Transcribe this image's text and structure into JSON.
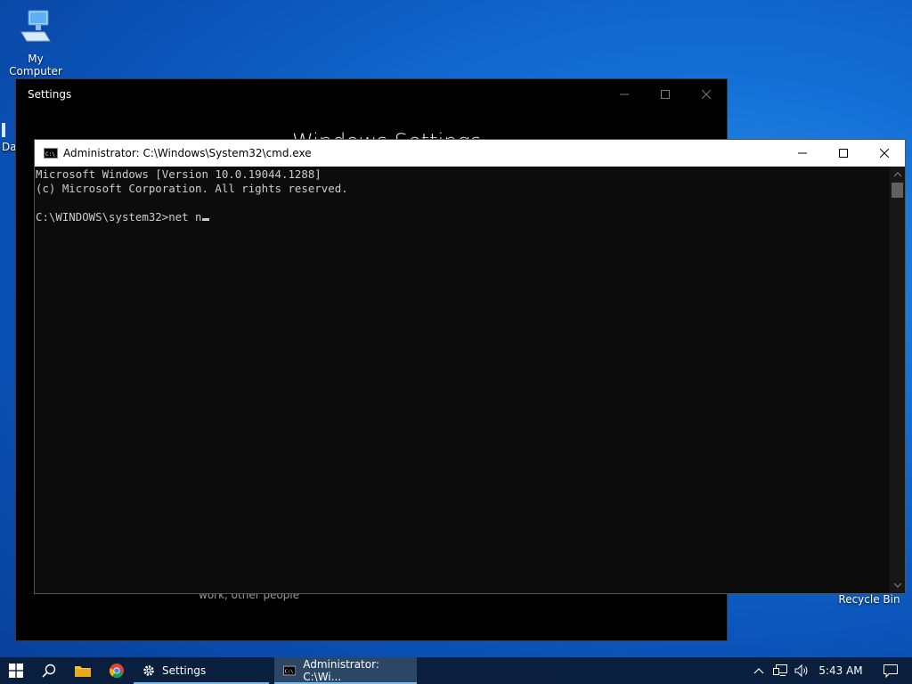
{
  "desktop": {
    "icons": [
      {
        "label": "My Computer",
        "icon": "computer-icon"
      },
      {
        "label": "Recycle Bin",
        "icon": "recycle-bin-icon"
      }
    ],
    "partial_icon_label": "Da"
  },
  "settings_window": {
    "title": "Settings",
    "heading": "Windows Settings",
    "caption": "work, other people"
  },
  "cmd_window": {
    "title": "Administrator: C:\\Windows\\System32\\cmd.exe",
    "lines": [
      "Microsoft Windows [Version 10.0.19044.1288]",
      "(c) Microsoft Corporation. All rights reserved.",
      "",
      "C:\\WINDOWS\\system32>net n"
    ]
  },
  "taskbar": {
    "apps": [
      {
        "label": "Settings",
        "icon": "gear-icon"
      },
      {
        "label": "Administrator: C:\\Wi...",
        "icon": "cmd-icon",
        "active": true
      }
    ],
    "clock": "5:43 AM",
    "colors": {
      "accent": "#76b9ed",
      "taskbar": "#0a1f3d"
    }
  }
}
